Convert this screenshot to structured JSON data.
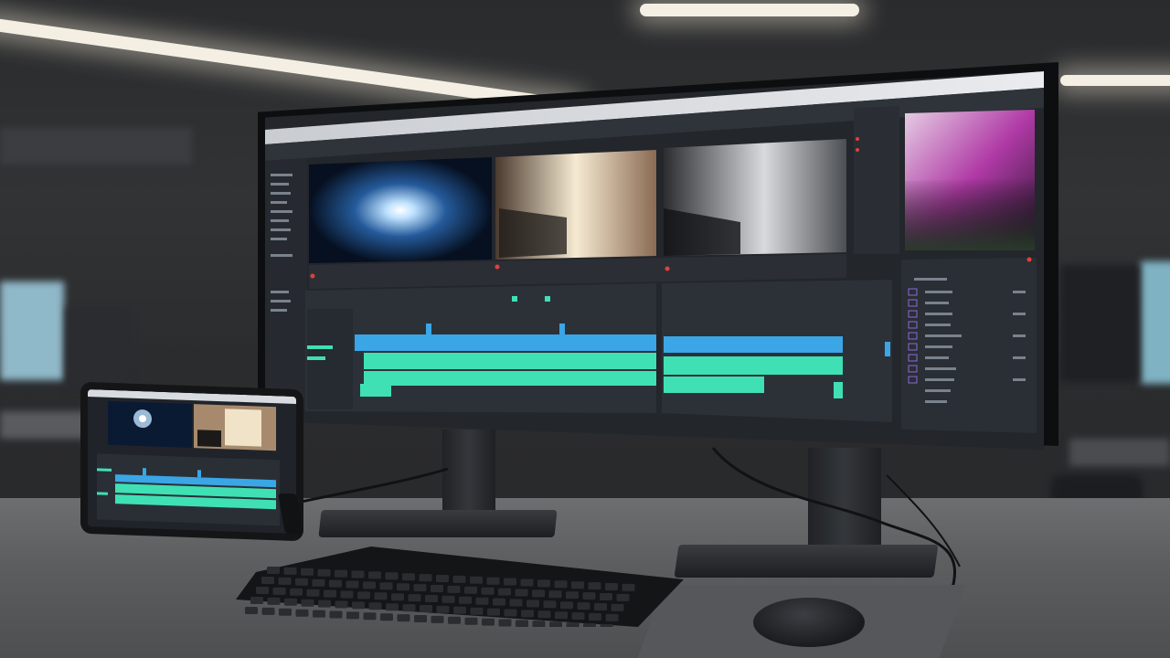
{
  "scene": {
    "description_role": "photo",
    "monitor_window_title": "",
    "accent_colors": {
      "clip_blue": "#3aa6e6",
      "clip_teal": "#3fe0b4",
      "record_red": "#e0413a",
      "swatch_purple": "#8a6ad8"
    },
    "icons": [
      "record-icon",
      "play-icon",
      "settings-icon"
    ]
  }
}
